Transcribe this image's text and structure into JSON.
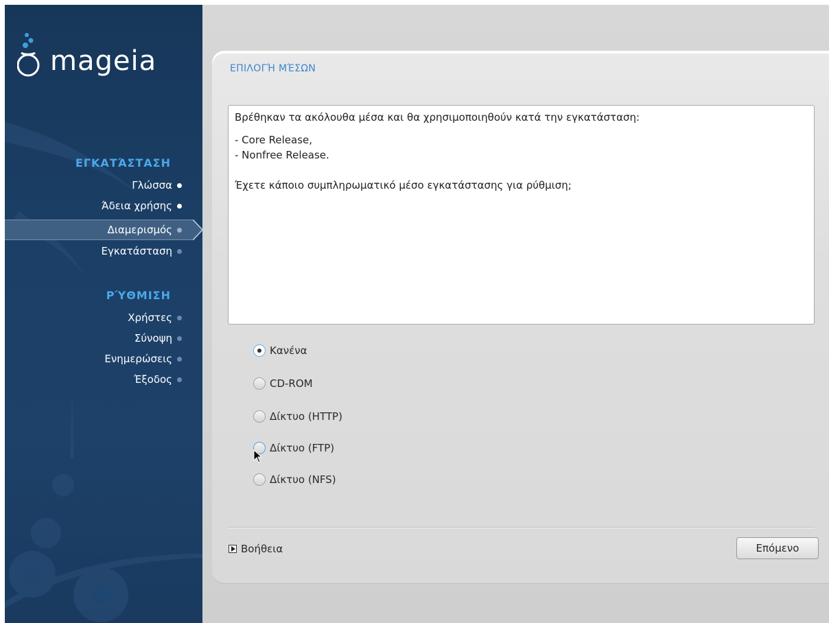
{
  "sidebar": {
    "logo_text": "mageia",
    "install_header": "ΕΓΚΑΤΆΣΤΑΣΗ",
    "install_steps": [
      {
        "label": "Γλώσσα",
        "state": "done"
      },
      {
        "label": "Άδεια χρήσης",
        "state": "done"
      },
      {
        "label": "Διαμερισμός",
        "state": "current"
      },
      {
        "label": "Εγκατάσταση",
        "state": "todo"
      }
    ],
    "config_header": "ΡΎΘΜΙΣΗ",
    "config_steps": [
      {
        "label": "Χρήστες",
        "state": "todo"
      },
      {
        "label": "Σύνοψη",
        "state": "todo"
      },
      {
        "label": "Ενημερώσεις",
        "state": "todo"
      },
      {
        "label": "Έξοδος",
        "state": "todo"
      }
    ]
  },
  "main": {
    "title": "ΕΠΙΛΟΓΉ ΜΈΣΩΝ",
    "info_lines": [
      "Βρέθηκαν τα ακόλουθα μέσα και θα χρησιμοποιηθούν κατά την εγκατάσταση:",
      "- Core Release,",
      "- Nonfree Release.",
      "Έχετε κάποιο συμπληρωματικό μέσο εγκατάστασης για ρύθμιση;"
    ],
    "options": [
      {
        "label": "Κανένα",
        "checked": true
      },
      {
        "label": "CD-ROM",
        "checked": false
      },
      {
        "label": "Δίκτυο (HTTP)",
        "checked": false
      },
      {
        "label": "Δίκτυο (FTP)",
        "checked": false
      },
      {
        "label": "Δίκτυο (NFS)",
        "checked": false
      }
    ],
    "help_label": "Βοήθεια",
    "next_label": "Επόμενο"
  },
  "colors": {
    "sidebar_bg": "#1b3f66",
    "section_header": "#4aa8e8",
    "title_blue": "#3b86c8"
  }
}
